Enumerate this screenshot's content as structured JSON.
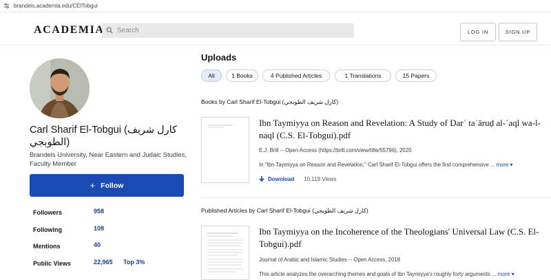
{
  "browser": {
    "url": "brandeis.academia.edu/CElTobgui"
  },
  "header": {
    "logo": "ACADEMIA",
    "search_placeholder": "Search",
    "login_label": "LOG IN",
    "signup_label": "SIGN UP"
  },
  "profile": {
    "name": "Carl Sharif El-Tobgui (كارل شريف الطوبجي)",
    "affiliation": "Brandeis University, Near Eastern and Judaic Studies, Faculty Member",
    "follow_label": "Follow",
    "stats": [
      {
        "label": "Followers",
        "value": "958",
        "extra": ""
      },
      {
        "label": "Following",
        "value": "108",
        "extra": ""
      },
      {
        "label": "Mentions",
        "value": "40",
        "extra": ""
      },
      {
        "label": "Public Views",
        "value": "22,965",
        "extra": "Top 3%"
      }
    ]
  },
  "uploads": {
    "title": "Uploads",
    "filters": [
      "All",
      "1 Books",
      "4 Published Articles",
      "1 Translations",
      "15 Papers"
    ],
    "active_filter": "All",
    "sections": [
      {
        "heading": "Books by Carl Sharif El-Tobgui (كارل شريف الطوبجي)",
        "work": {
          "title": "Ibn Taymiyya on Reason and Revelation: A Study of Darʾ taʿāruḍ al-ʿaql wa-l-naql (C.S. El-Tobgui).pdf",
          "source": "E.J. Brill -- Open Access (https://brill.com/view/title/55796), 2020",
          "abstract": "In \"Ibn Taymiyya on Reason and Revelation,\" Carl Sharif El-Tobgui offers the first comprehensive ...",
          "more_label": "more",
          "download_label": "Download",
          "views": "10,119 Views"
        }
      },
      {
        "heading": "Published Articles by Carl Sharif El-Tobgui (كارل شريف الطوبجي)",
        "work": {
          "title": "Ibn Taymiyya on the Incoherence of the Theologians' Universal Law (C.S. El-Tobgui).pdf",
          "source": "Journal of Arabic and Islamic Studies -- Open Access, 2018",
          "abstract": "This article analyzes the overarching themes and goals of Ibn Taymiyya's roughly forty arguments ...",
          "more_label": "more"
        }
      }
    ]
  },
  "colors": {
    "primary": "#1a4ab3",
    "stat_value": "#1a3d8f",
    "chip_active": "#e5ecfa"
  },
  "icons": {
    "url_bar": "tune-icon",
    "search": "search-icon",
    "follow": "plus-icon",
    "more": "caret-down-icon",
    "download": "download-arrow-icon"
  }
}
